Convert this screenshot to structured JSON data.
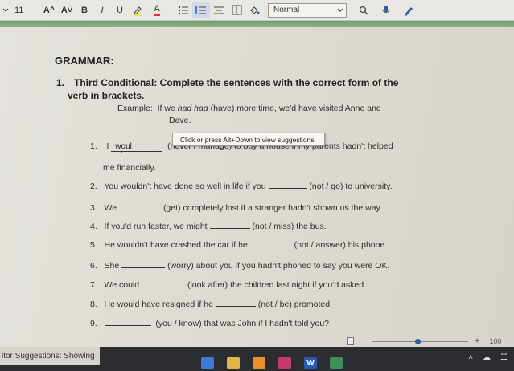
{
  "toolbar": {
    "font_size": "11",
    "grow_font": "A^",
    "shrink_font": "A˅",
    "bold": "B",
    "italic": "I",
    "underline": "U",
    "font_color_letter": "A",
    "style_value": "Normal",
    "icons": [
      "chevron-down-icon",
      "grow-font-icon",
      "shrink-font-icon",
      "bold-icon",
      "italic-icon",
      "underline-icon",
      "highlighter-icon",
      "font-color-icon",
      "bullets-icon",
      "numbering-icon",
      "align-icon",
      "borders-icon",
      "shading-icon",
      "search-icon",
      "dictate-icon",
      "editor-icon"
    ]
  },
  "document": {
    "heading": "GRAMMAR:",
    "question": {
      "number": "1.",
      "title_line1": "Third Conditional: Complete the sentences with the correct form of the",
      "title_line2": "verb in brackets."
    },
    "example": {
      "label": "Example:",
      "before": "If we",
      "underlined": "had had",
      "after": "(have) more time, we'd have visited Anne and",
      "line2": "Dave."
    },
    "items": [
      {
        "num": "1.",
        "pre": "I",
        "typed": "woul",
        "post": "(never / manage) to buy a house if my parents hadn't helped",
        "line2": "me financially."
      },
      {
        "num": "2.",
        "pre": "You wouldn't have done so well in life if you",
        "post": "(not / go) to university."
      },
      {
        "num": "3.",
        "pre": "We",
        "post": "(get) completely lost if a stranger hadn't shown us the way."
      },
      {
        "num": "4.",
        "pre": "If you'd run faster, we might",
        "post": "(not / miss) the bus."
      },
      {
        "num": "5.",
        "pre": "He wouldn't have crashed the car if he",
        "post": "(not / answer) his phone."
      },
      {
        "num": "6.",
        "pre": "She",
        "post": "(worry) about you if you hadn't phoned to say you were OK."
      },
      {
        "num": "7.",
        "pre": "We could",
        "post": "(look after) the children last night if you'd asked."
      },
      {
        "num": "8.",
        "pre": "He would have resigned if he",
        "post": "(not / be) promoted."
      },
      {
        "num": "9.",
        "pre": "",
        "post": "(you / know) that was John if I hadn't told you?"
      }
    ],
    "tooltip": "Click or press Alt+Down to view suggestions"
  },
  "zoom": {
    "plus": "+",
    "level": "100"
  },
  "status": {
    "editor_suggestions": "itor Suggestions: Showing"
  },
  "taskbar_icons": [
    "windows-icon",
    "file-explorer-icon",
    "mail-icon",
    "word-icon",
    "app-icon"
  ]
}
